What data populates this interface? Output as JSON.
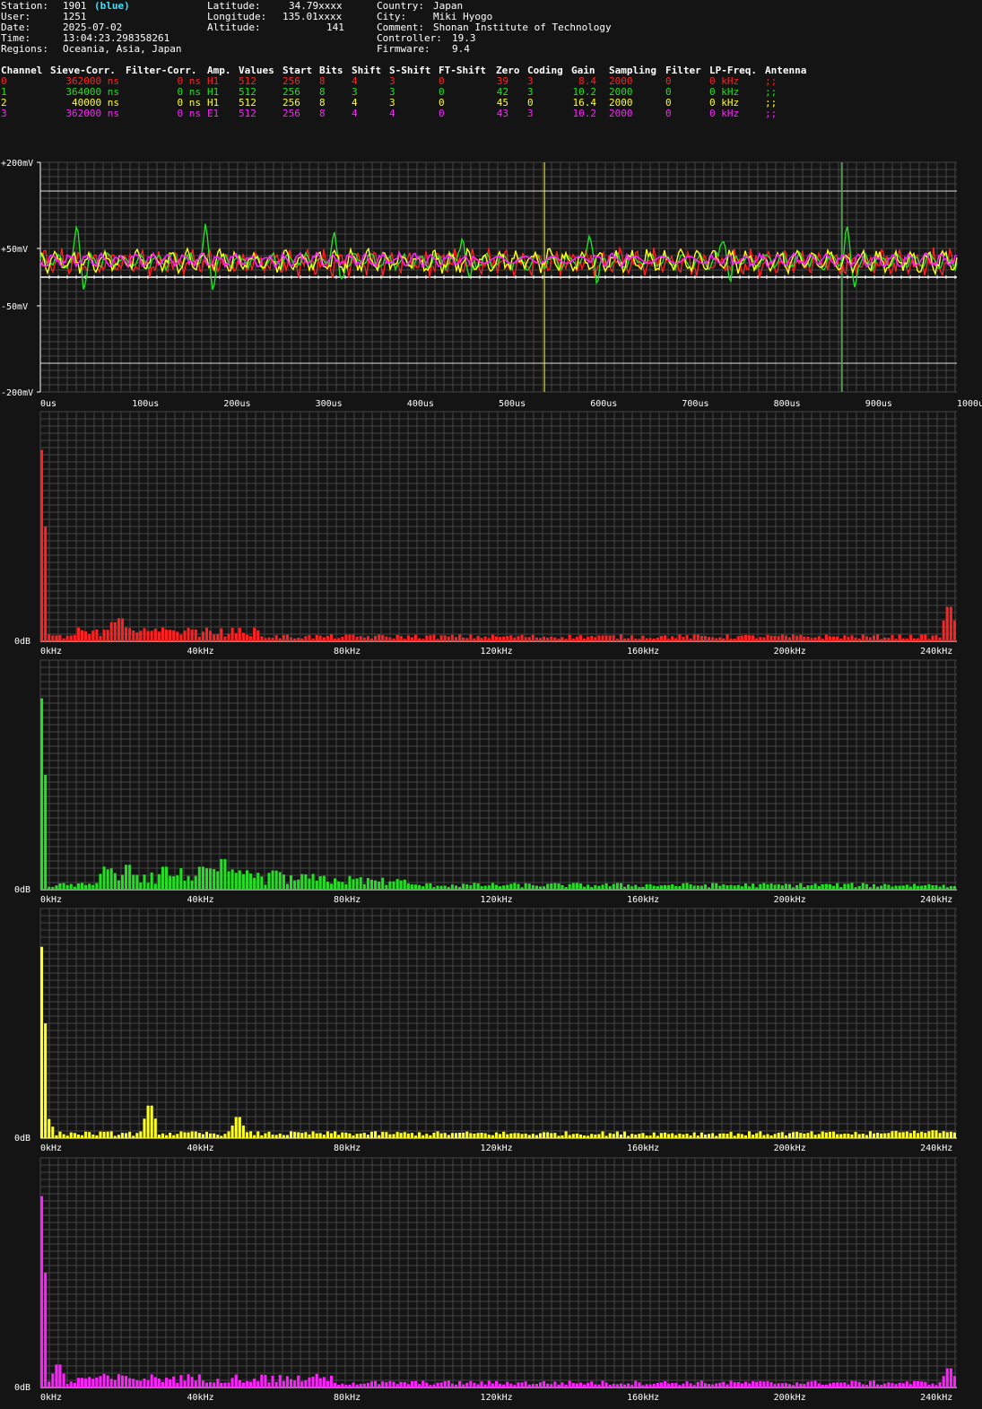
{
  "header": {
    "station_label": "Station:",
    "station_value": "1901",
    "station_color": "(blue)",
    "user_label": "User:",
    "user_value": "1251",
    "date_label": "Date:",
    "date_value": "2025-07-02",
    "time_label": "Time:",
    "time_value": "13:04:23.298358261",
    "regions_label": "Regions:",
    "regions_value": "Oceania, Asia, Japan",
    "lat_label": "Latitude:",
    "lat_value": "34.79xxxx",
    "lon_label": "Longitude:",
    "lon_value": "135.01xxxx",
    "alt_label": "Altitude:",
    "alt_value": "141",
    "country_label": "Country:",
    "country_value": "Japan",
    "city_label": "City:",
    "city_value": "Miki Hyogo",
    "comment_label": "Comment:",
    "comment_value": "Shonan Institute of Technology",
    "controller_label": "Controller:",
    "controller_value": "19.3",
    "firmware_label": "Firmware:",
    "firmware_value": "9.4"
  },
  "table": {
    "columns": [
      "Channel",
      "Sieve-Corr.",
      "Filter-Corr.",
      "Amp.",
      "Values",
      "Start",
      "Bits",
      "Shift",
      "S-Shift",
      "FT-Shift",
      "Zero",
      "Coding",
      "Gain",
      "Sampling",
      "Filter",
      "LP-Freq.",
      "Antenna"
    ],
    "rows": [
      {
        "color": "#ff2020",
        "cells": [
          "0",
          "362000 ns",
          "0 ns",
          "H1",
          "512",
          "256",
          "8",
          "4",
          "3",
          "0",
          "39",
          "3",
          "8.4",
          "2000",
          "0",
          "0 kHz",
          ";;"
        ]
      },
      {
        "color": "#20e020",
        "cells": [
          "1",
          "364000 ns",
          "0 ns",
          "H1",
          "512",
          "256",
          "8",
          "3",
          "3",
          "0",
          "42",
          "3",
          "10.2",
          "2000",
          "0",
          "0 kHz",
          ";;"
        ]
      },
      {
        "color": "#ffff20",
        "cells": [
          "2",
          "40000 ns",
          "0 ns",
          "H1",
          "512",
          "256",
          "8",
          "4",
          "3",
          "0",
          "45",
          "0",
          "16.4",
          "2000",
          "0",
          "0 kHz",
          ";;"
        ]
      },
      {
        "color": "#ff20ff",
        "cells": [
          "3",
          "362000 ns",
          "0 ns",
          "E1",
          "512",
          "256",
          "8",
          "4",
          "4",
          "0",
          "43",
          "3",
          "10.2",
          "2000",
          "0",
          "0 kHz",
          ";;"
        ]
      }
    ]
  },
  "colors": {
    "background": "#141414",
    "ch0": "#ff2020",
    "ch1": "#20e020",
    "ch2": "#ffff20",
    "ch3": "#ff20ff",
    "white_line": "#ffffff",
    "grid": "#444444"
  },
  "chart_data": [
    {
      "type": "line",
      "ylim": [
        -200,
        200
      ],
      "ytick_labels": [
        "+200mV",
        "+50mV",
        "-50mV",
        "-200mV"
      ],
      "xlim": [
        0,
        1000
      ],
      "xtick_labels": [
        "0us",
        "100us",
        "200us",
        "300us",
        "400us",
        "500us",
        "600us",
        "700us",
        "800us",
        "900us",
        "1000us"
      ],
      "markers_us": [
        {
          "x": 550,
          "color": "#ffff20"
        },
        {
          "x": 874,
          "color": "#20e020"
        },
        {
          "x": 875,
          "color": "#ff20ff"
        }
      ],
      "series": [
        {
          "channel": "0",
          "baseline_mv": 25,
          "amplitude_mv": 12
        },
        {
          "channel": "1",
          "baseline_mv": 28,
          "amplitude_mv": 10,
          "spikes_us": [
            40,
            180,
            320,
            460,
            600,
            745,
            880
          ]
        },
        {
          "channel": "2",
          "baseline_mv": 28,
          "amplitude_mv": 14
        },
        {
          "channel": "3",
          "baseline_mv": 30,
          "amplitude_mv": 8
        }
      ]
    },
    {
      "type": "bar",
      "channel": "0",
      "ylabel": "0dB",
      "xtick_labels": [
        "0kHz",
        "40kHz",
        "80kHz",
        "120kHz",
        "160kHz",
        "200kHz",
        "240kHz"
      ],
      "xlim_khz": [
        0,
        250
      ],
      "peak_khz": [
        [
          0,
          1.0
        ],
        [
          20,
          0.1
        ],
        [
          22,
          0.12
        ],
        [
          248,
          0.18
        ]
      ]
    },
    {
      "type": "bar",
      "channel": "1",
      "ylabel": "0dB",
      "xtick_labels": [
        "0kHz",
        "40kHz",
        "80kHz",
        "120kHz",
        "160kHz",
        "200kHz",
        "240kHz"
      ],
      "xlim_khz": [
        0,
        250
      ],
      "peak_khz": [
        [
          0,
          1.0
        ],
        [
          24,
          0.13
        ],
        [
          34,
          0.12
        ],
        [
          44,
          0.12
        ],
        [
          50,
          0.16
        ],
        [
          64,
          0.1
        ]
      ]
    },
    {
      "type": "bar",
      "channel": "2",
      "ylabel": "0dB",
      "xtick_labels": [
        "0kHz",
        "40kHz",
        "80kHz",
        "120kHz",
        "160kHz",
        "200kHz",
        "240kHz"
      ],
      "xlim_khz": [
        0,
        250
      ],
      "peak_khz": [
        [
          0,
          1.0
        ],
        [
          2,
          0.1
        ],
        [
          30,
          0.17
        ],
        [
          54,
          0.11
        ]
      ]
    },
    {
      "type": "bar",
      "channel": "3",
      "ylabel": "0dB",
      "xtick_labels": [
        "0kHz",
        "40kHz",
        "80kHz",
        "120kHz",
        "160kHz",
        "200kHz",
        "240kHz"
      ],
      "xlim_khz": [
        0,
        250
      ],
      "peak_khz": [
        [
          0,
          1.0
        ],
        [
          5,
          0.12
        ],
        [
          248,
          0.1
        ]
      ]
    }
  ]
}
